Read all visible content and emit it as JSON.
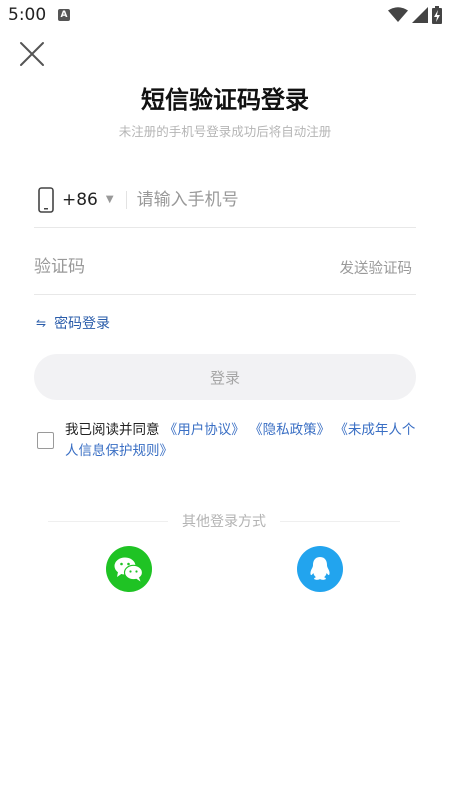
{
  "status_bar": {
    "time": "5:00",
    "notification_icon": "a-notification-icon",
    "wifi_icon": "wifi-icon",
    "signal_icon": "signal-icon",
    "battery_icon": "battery-charging-icon"
  },
  "header": {
    "title": "短信验证码登录",
    "subtitle": "未注册的手机号登录成功后将自动注册"
  },
  "phone_field": {
    "country_code": "+86",
    "dropdown_arrow": "▼",
    "placeholder": "请输入手机号",
    "value": ""
  },
  "code_field": {
    "placeholder": "验证码",
    "value": "",
    "send_label": "发送验证码"
  },
  "password_login": {
    "icon": "⇋",
    "label": "密码登录"
  },
  "login_button": {
    "label": "登录"
  },
  "agreement": {
    "checked": false,
    "prefix": "我已阅读并同意",
    "link_user": "《用户协议》",
    "link_privacy": "《隐私政策》",
    "link_minor": "《未成年人个人信息保护规则》"
  },
  "other_login": {
    "title": "其他登录方式",
    "methods": [
      "wechat",
      "qq"
    ]
  },
  "colors": {
    "link": "#3a6fc4",
    "wechat": "#1fc324",
    "qq": "#22a4ee",
    "login_bg": "#f2f2f4"
  }
}
